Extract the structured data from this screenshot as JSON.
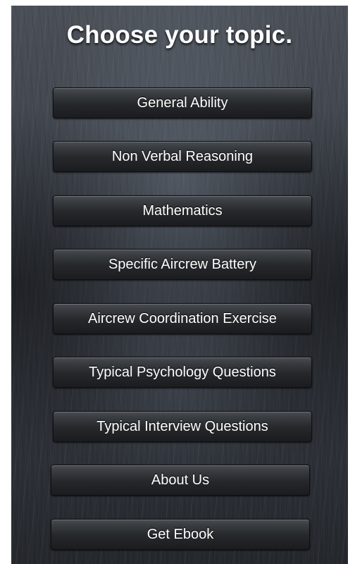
{
  "page_title": "Choose your topic.",
  "menu": {
    "items": [
      {
        "label": "General Ability"
      },
      {
        "label": "Non Verbal Reasoning"
      },
      {
        "label": "Mathematics"
      },
      {
        "label": "Specific Aircrew Battery"
      },
      {
        "label": "Aircrew Coordination Exercise"
      },
      {
        "label": "Typical Psychology Questions"
      },
      {
        "label": "Typical Interview Questions"
      },
      {
        "label": "About Us"
      },
      {
        "label": "Get Ebook"
      }
    ]
  },
  "colors": {
    "background": "#3b4048",
    "button": "#25272a",
    "text": "#ffffff"
  }
}
